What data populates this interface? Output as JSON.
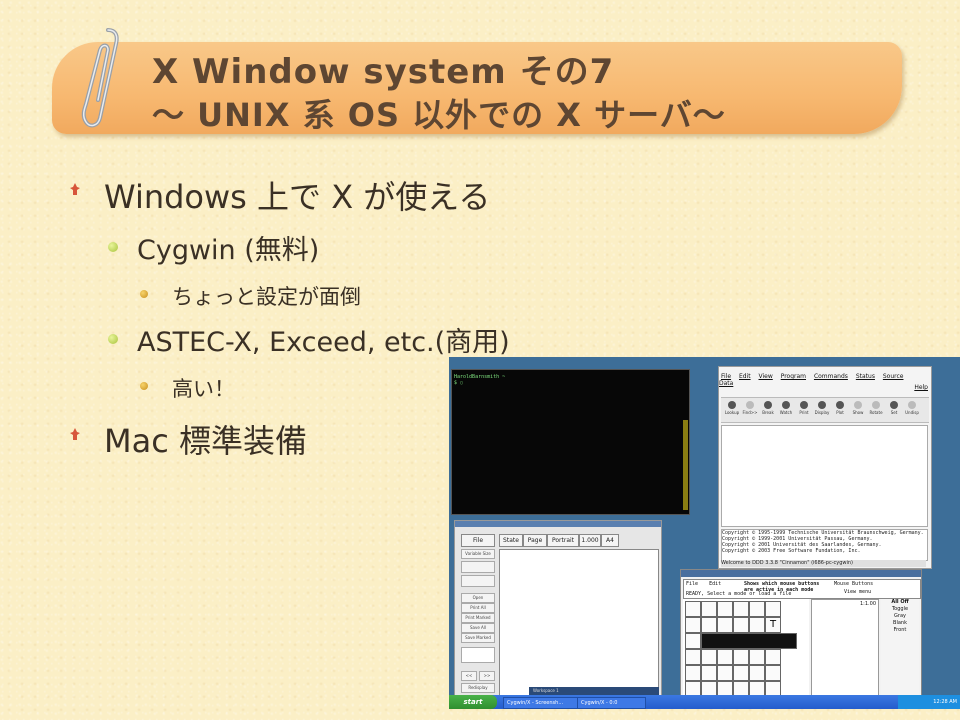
{
  "title": {
    "line1": "X Window system  その7",
    "line2": "～ UNIX 系 OS 以外での X サーバ～"
  },
  "bullets": [
    {
      "level": 1,
      "text": "Windows 上で X が使える"
    },
    {
      "level": 2,
      "text": "Cygwin (無料)"
    },
    {
      "level": 3,
      "text": "ちょっと設定が面倒"
    },
    {
      "level": 2,
      "text": "ASTEC-X, Exceed, etc.(商用)"
    },
    {
      "level": 3,
      "text": "高い！"
    },
    {
      "level": 1,
      "text": "Mac  標準装備"
    }
  ],
  "screenshot": {
    "terminal": {
      "prompt": "HaroldBarnsmith ~\n$ ▯"
    },
    "ddd": {
      "menus": [
        "File",
        "Edit",
        "View",
        "Program",
        "Commands",
        "Status",
        "Source",
        "Data",
        "Help"
      ],
      "tools": [
        "Lookup",
        "Find>>",
        "Break",
        "Watch",
        "Print",
        "Display",
        "Plot",
        "Show",
        "Rotate",
        "Set",
        "Undisp"
      ],
      "console": [
        "Copyright © 1995-1999 Technische Universität Braunschweig, Germany.",
        "Copyright © 1999-2001 Universität Passau, Germany.",
        "Copyright © 2001 Universität des Saarlandes, Germany.",
        "Copyright © 2003 Free Software Fundation, Inc."
      ],
      "status": "Welcome to DDD 3.3.8 \"Cinnamon\" (i686-pc-cygwin)"
    },
    "ghostview": {
      "buttons": [
        "File",
        "State",
        "Page",
        "Portrait",
        "1.000",
        "A4"
      ],
      "side": [
        "Variable Size",
        "Open",
        "Print All",
        "Print Marked",
        "Save All",
        "Save Marked"
      ],
      "nav": [
        "<<",
        ">>",
        "Redisplay"
      ]
    },
    "xfig": {
      "file_btn": "File",
      "edit_btn": "Edit",
      "message": "Shows which mouse buttons\nare active in each mode",
      "ready": "READY, Select a mode or load a file",
      "mouse_buttons": "Mouse Buttons",
      "view_menu": "View menu",
      "zoom": "1:1.00",
      "panel": [
        "All Off",
        "Toggle",
        "Gray",
        "Blank",
        "Front"
      ]
    },
    "taskbar": {
      "start": "start",
      "tasks": [
        "Cygwin/X - Screensh...",
        "Cygwin/X - 0:0"
      ],
      "clock": "12:28 AM",
      "workspace": "Workspace 1"
    }
  }
}
